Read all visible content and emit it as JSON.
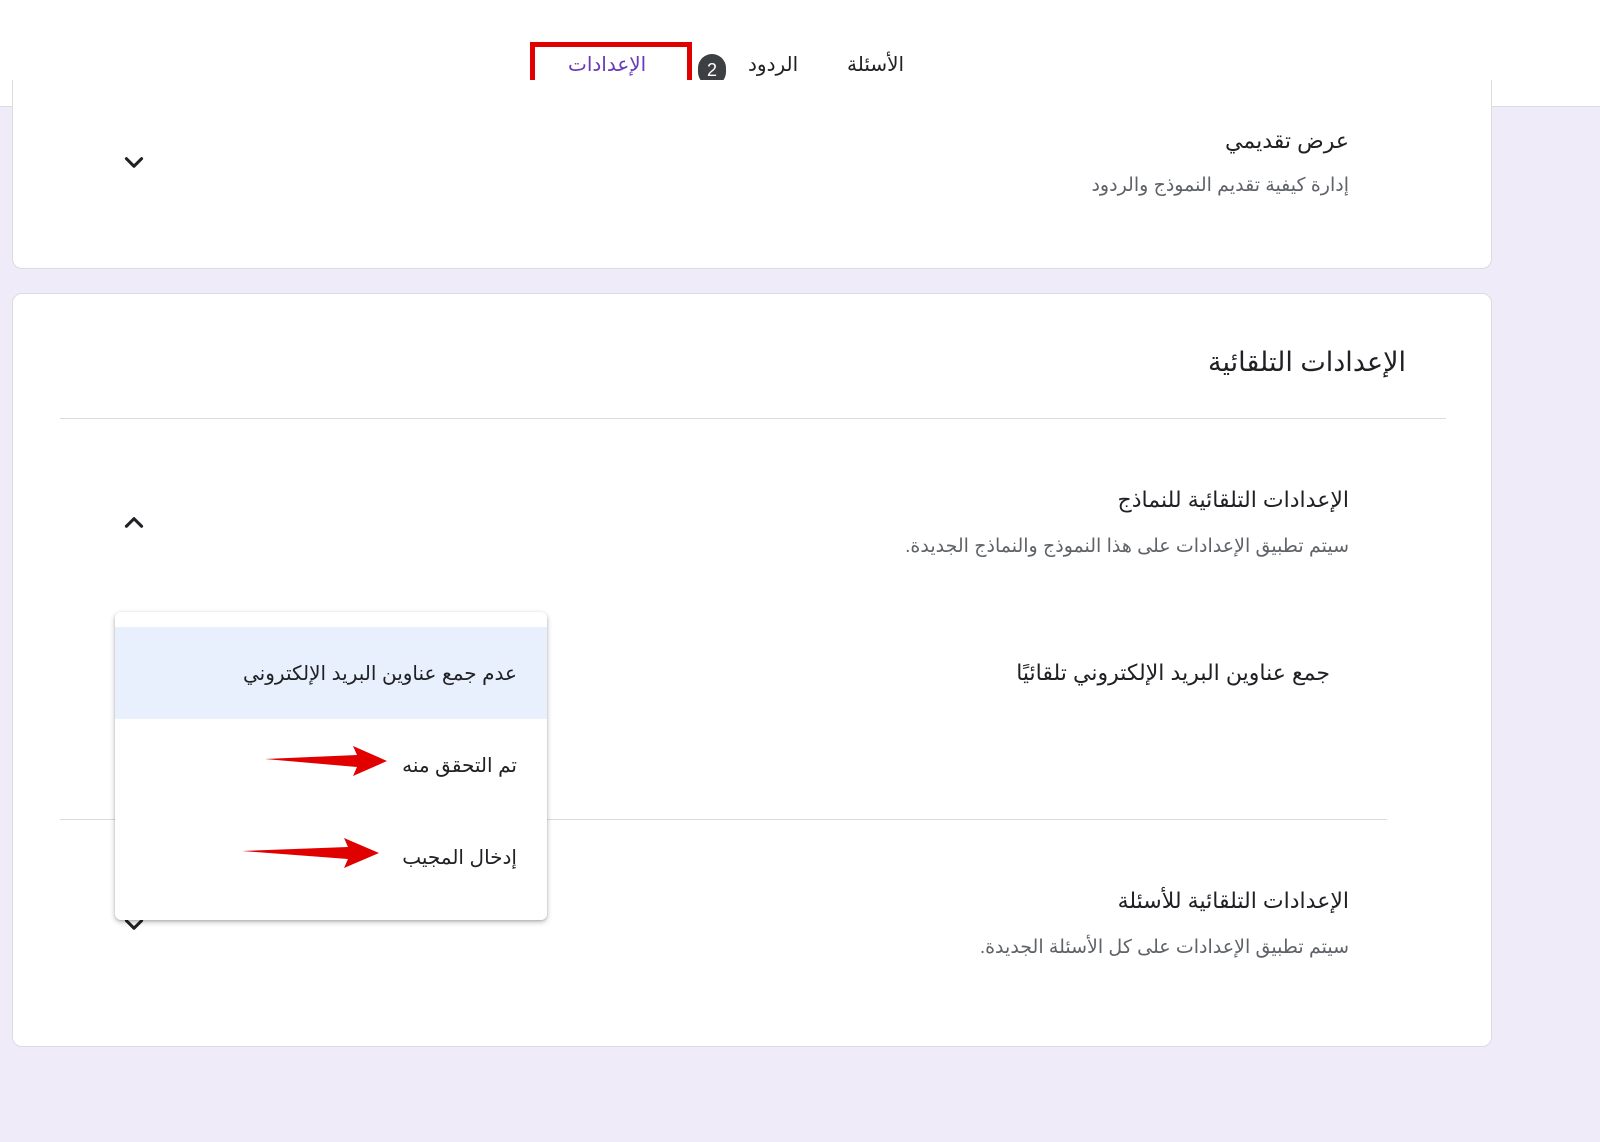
{
  "tabs": {
    "questions": "الأسئلة",
    "responses": "الردود",
    "responses_badge": "2",
    "settings": "الإعدادات"
  },
  "presentation": {
    "title": "عرض تقديمي",
    "description": "إدارة كيفية تقديم النموذج والردود"
  },
  "defaults": {
    "title": "الإعدادات التلقائية",
    "forms": {
      "title": "الإعدادات التلقائية للنماذج",
      "description": "سيتم تطبيق الإعدادات على هذا النموذج والنماذج الجديدة.",
      "collect_emails_label": "جمع عناوين البريد الإلكتروني تلقائيًا"
    },
    "questions": {
      "title": "الإعدادات التلقائية للأسئلة",
      "description": "سيتم تطبيق الإعدادات على كل الأسئلة الجديدة."
    }
  },
  "dropdown": {
    "options": [
      "عدم جمع عناوين البريد الإلكتروني",
      "تم التحقق منه",
      "إدخال المجيب"
    ],
    "selected_index": 0
  },
  "colors": {
    "accent": "#673ab7",
    "annotation_red": "#e00000",
    "background": "#f0ebf8"
  },
  "icons": [
    "chevron-down-icon",
    "chevron-up-icon",
    "red-arrow-annotation"
  ]
}
